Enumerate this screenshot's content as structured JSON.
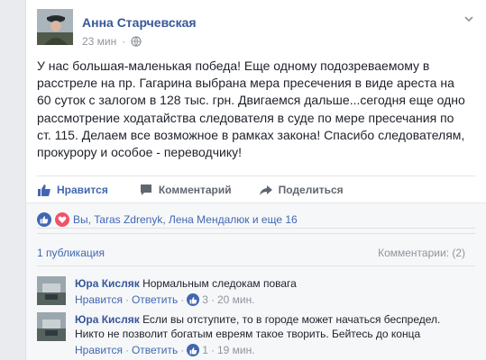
{
  "post": {
    "author": "Анна Старчевская",
    "time": "23 мин",
    "text": "У нас большая-маленькая победа! Еще одному подозреваемому в расстреле на пр. Гагарина выбрана мера пресечения в виде ареста на 60 суток с залогом в 128 тыс. грн. Двигаемся дальше...сегодня еще одно рассмотрение ходатайства следователя в суде по мере пресечания по ст. 115. Делаем все возможное в рамках закона! Спасибо следователям, прокурору и особое - переводчику!"
  },
  "actions": {
    "like": "Нравится",
    "comment": "Комментарий",
    "share": "Поделиться"
  },
  "reactions": {
    "text": "Вы, Taras Zdrenyk, Лена Мендалюк и еще 16"
  },
  "publications": "1 публикация",
  "comments_count": "Комментарии: (2)",
  "comments": [
    {
      "author": "Юра Кисляк",
      "text": "Нормальным следокам повага",
      "like": "Нравится",
      "reply": "Ответить",
      "likes": "3",
      "time": "20 мин."
    },
    {
      "author": "Юра Кисляк",
      "text": "Если вы отступите, то в городе может начаться беспредел. Никто не позволит богатым евреям такое творить. Бейтесь до конца",
      "like": "Нравится",
      "reply": "Ответить",
      "likes": "1",
      "time": "19 мин."
    }
  ],
  "colors": {
    "link": "#365899",
    "accent": "#4267b2",
    "muted": "#90949c",
    "love": "#f25268"
  }
}
